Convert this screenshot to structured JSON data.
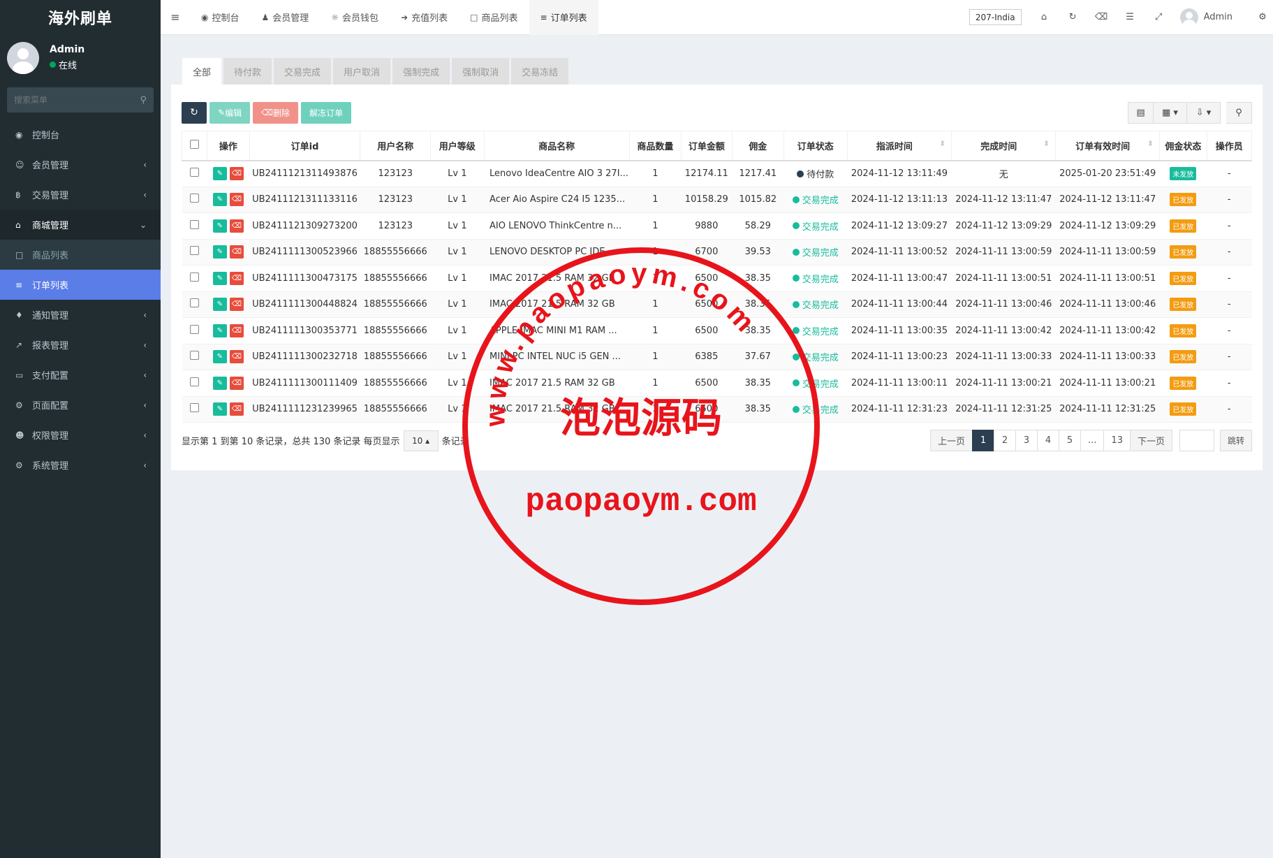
{
  "brand": "海外刷单",
  "user": {
    "name": "Admin",
    "status": "在线"
  },
  "search": {
    "placeholder": "搜索菜单"
  },
  "sidebar": {
    "items": [
      {
        "label": "控制台",
        "icon": "dashboard-icon"
      },
      {
        "label": "会员管理",
        "icon": "user-circle-icon"
      },
      {
        "label": "交易管理",
        "icon": "bitcoin-icon"
      },
      {
        "label": "商城管理",
        "icon": "home-icon"
      },
      {
        "label": "商品列表",
        "icon": "desktop-icon"
      },
      {
        "label": "订单列表",
        "icon": "list-icon"
      },
      {
        "label": "通知管理",
        "icon": "bell-icon"
      },
      {
        "label": "报表管理",
        "icon": "line-chart-icon"
      },
      {
        "label": "支付配置",
        "icon": "credit-card-icon"
      },
      {
        "label": "页面配置",
        "icon": "gear-icon"
      },
      {
        "label": "权限管理",
        "icon": "users-icon"
      },
      {
        "label": "系统管理",
        "icon": "cogs-icon"
      }
    ]
  },
  "topnav": {
    "tabs": [
      {
        "label": "控制台",
        "icon": "dashboard-icon"
      },
      {
        "label": "会员管理",
        "icon": "user-icon"
      },
      {
        "label": "会员钱包",
        "icon": "wallet-icon"
      },
      {
        "label": "充值列表",
        "icon": "sign-in-icon"
      },
      {
        "label": "商品列表",
        "icon": "desktop-icon"
      },
      {
        "label": "订单列表",
        "icon": "list-icon"
      }
    ],
    "region": "207-India",
    "admin": "Admin"
  },
  "filter_tabs": [
    "全部",
    "待付款",
    "交易完成",
    "用户取消",
    "强制完成",
    "强制取消",
    "交易冻结"
  ],
  "toolbar": {
    "edit": "编辑",
    "delete": "删除",
    "unfreeze": "解冻订单"
  },
  "table": {
    "headers": [
      "操作",
      "订单id",
      "用户名称",
      "用户等级",
      "商品名称",
      "商品数量",
      "订单金额",
      "佣金",
      "订单状态",
      "指派时间",
      "完成时间",
      "订单有效时间",
      "佣金状态",
      "操作员"
    ],
    "rows": [
      {
        "id": "UB2411121311493876",
        "user": "123123",
        "level": "Lv 1",
        "product": "Lenovo IdeaCentre AIO 3 27I...",
        "qty": "1",
        "amount": "12174.11",
        "commission": "1217.41",
        "status": "待付款",
        "assigned": "2024-11-12 13:11:49",
        "completed": "无",
        "valid": "2025-01-20 23:51:49",
        "cstatus": "未发放",
        "operator": "-"
      },
      {
        "id": "UB2411121311133116",
        "user": "123123",
        "level": "Lv 1",
        "product": "Acer Aio Aspire C24 I5 1235...",
        "qty": "1",
        "amount": "10158.29",
        "commission": "1015.82",
        "status": "交易完成",
        "assigned": "2024-11-12 13:11:13",
        "completed": "2024-11-12 13:11:47",
        "valid": "2024-11-12 13:11:47",
        "cstatus": "已发放",
        "operator": "-"
      },
      {
        "id": "UB2411121309273200",
        "user": "123123",
        "level": "Lv 1",
        "product": "AIO LENOVO ThinkCentre n...",
        "qty": "1",
        "amount": "9880",
        "commission": "58.29",
        "status": "交易完成",
        "assigned": "2024-11-12 13:09:27",
        "completed": "2024-11-12 13:09:29",
        "valid": "2024-11-12 13:09:29",
        "cstatus": "已发放",
        "operator": "-"
      },
      {
        "id": "UB2411111300523966",
        "user": "18855556666",
        "level": "Lv 1",
        "product": "LENOVO DESKTOP PC IDE...",
        "qty": "1",
        "amount": "6700",
        "commission": "39.53",
        "status": "交易完成",
        "assigned": "2024-11-11 13:00:52",
        "completed": "2024-11-11 13:00:59",
        "valid": "2024-11-11 13:00:59",
        "cstatus": "已发放",
        "operator": "-"
      },
      {
        "id": "UB2411111300473175",
        "user": "18855556666",
        "level": "Lv 1",
        "product": "IMAC 2017 21.5 RAM 32 GB",
        "qty": "1",
        "amount": "6500",
        "commission": "38.35",
        "status": "交易完成",
        "assigned": "2024-11-11 13:00:47",
        "completed": "2024-11-11 13:00:51",
        "valid": "2024-11-11 13:00:51",
        "cstatus": "已发放",
        "operator": "-"
      },
      {
        "id": "UB2411111300448824",
        "user": "18855556666",
        "level": "Lv 1",
        "product": "IMAC 2017 21.5 RAM 32 GB",
        "qty": "1",
        "amount": "6500",
        "commission": "38.35",
        "status": "交易完成",
        "assigned": "2024-11-11 13:00:44",
        "completed": "2024-11-11 13:00:46",
        "valid": "2024-11-11 13:00:46",
        "cstatus": "已发放",
        "operator": "-"
      },
      {
        "id": "UB2411111300353771",
        "user": "18855556666",
        "level": "Lv 1",
        "product": "APPLE IMAC MINI M1 RAM ...",
        "qty": "1",
        "amount": "6500",
        "commission": "38.35",
        "status": "交易完成",
        "assigned": "2024-11-11 13:00:35",
        "completed": "2024-11-11 13:00:42",
        "valid": "2024-11-11 13:00:42",
        "cstatus": "已发放",
        "operator": "-"
      },
      {
        "id": "UB2411111300232718",
        "user": "18855556666",
        "level": "Lv 1",
        "product": "MINI PC INTEL NUC i5 GEN ...",
        "qty": "1",
        "amount": "6385",
        "commission": "37.67",
        "status": "交易完成",
        "assigned": "2024-11-11 13:00:23",
        "completed": "2024-11-11 13:00:33",
        "valid": "2024-11-11 13:00:33",
        "cstatus": "已发放",
        "operator": "-"
      },
      {
        "id": "UB2411111300111409",
        "user": "18855556666",
        "level": "Lv 1",
        "product": "IMAC 2017 21.5 RAM 32 GB",
        "qty": "1",
        "amount": "6500",
        "commission": "38.35",
        "status": "交易完成",
        "assigned": "2024-11-11 13:00:11",
        "completed": "2024-11-11 13:00:21",
        "valid": "2024-11-11 13:00:21",
        "cstatus": "已发放",
        "operator": "-"
      },
      {
        "id": "UB2411111231239965",
        "user": "18855556666",
        "level": "Lv 1",
        "product": "IMAC 2017 21.5 RAM 32 GB",
        "qty": "1",
        "amount": "6500",
        "commission": "38.35",
        "status": "交易完成",
        "assigned": "2024-11-11 12:31:23",
        "completed": "2024-11-11 12:31:25",
        "valid": "2024-11-11 12:31:25",
        "cstatus": "已发放",
        "operator": "-"
      }
    ]
  },
  "pagination": {
    "summary": "显示第 1 到第 10 条记录，总共 130 条记录 每页显示",
    "page_size": "10",
    "suffix": "条记录",
    "prev": "上一页",
    "pages": [
      "1",
      "2",
      "3",
      "4",
      "5",
      "...",
      "13"
    ],
    "next": "下一页",
    "jump": "跳转"
  },
  "watermark": {
    "url_arc": "www.paopaoym.com",
    "cn": "泡泡源码",
    "url": "paopaoym.com",
    "color": "#e8141b"
  },
  "colors": {
    "sidebar": "#222d32",
    "active_menu": "#5b7de8",
    "success": "#18bc9c",
    "danger": "#e74c3c",
    "warning": "#f39c12",
    "primary_dark": "#2c3e50"
  }
}
